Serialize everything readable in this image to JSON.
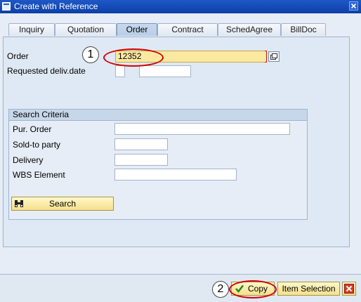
{
  "window": {
    "title": "Create with Reference"
  },
  "tabs": [
    {
      "label": "Inquiry"
    },
    {
      "label": "Quotation"
    },
    {
      "label": "Order"
    },
    {
      "label": "Contract"
    },
    {
      "label": "SchedAgree"
    },
    {
      "label": "BillDoc"
    }
  ],
  "active_tab": "Order",
  "order": {
    "label": "Order",
    "value": "12352"
  },
  "requested_deliv_date": {
    "label": "Requested deliv.date",
    "value": ""
  },
  "search_criteria": {
    "title": "Search Criteria",
    "fields": [
      {
        "label": "Pur. Order",
        "value": ""
      },
      {
        "label": "Sold-to party",
        "value": ""
      },
      {
        "label": "Delivery",
        "value": ""
      },
      {
        "label": "WBS Element",
        "value": ""
      }
    ],
    "search_button": "Search"
  },
  "footer": {
    "copy_button": "Copy",
    "item_selection_button": "Item Selection"
  },
  "callouts": [
    "1",
    "2"
  ],
  "colors": {
    "titlebar": "#1e58c7",
    "required_field": "#fbe9a2",
    "button": "#f4e08b",
    "callout_ring": "#d40000"
  },
  "icons": [
    "sap-window-icon",
    "close-icon",
    "value-help-icon",
    "binoculars-icon",
    "checkmark-icon",
    "cancel-icon"
  ]
}
